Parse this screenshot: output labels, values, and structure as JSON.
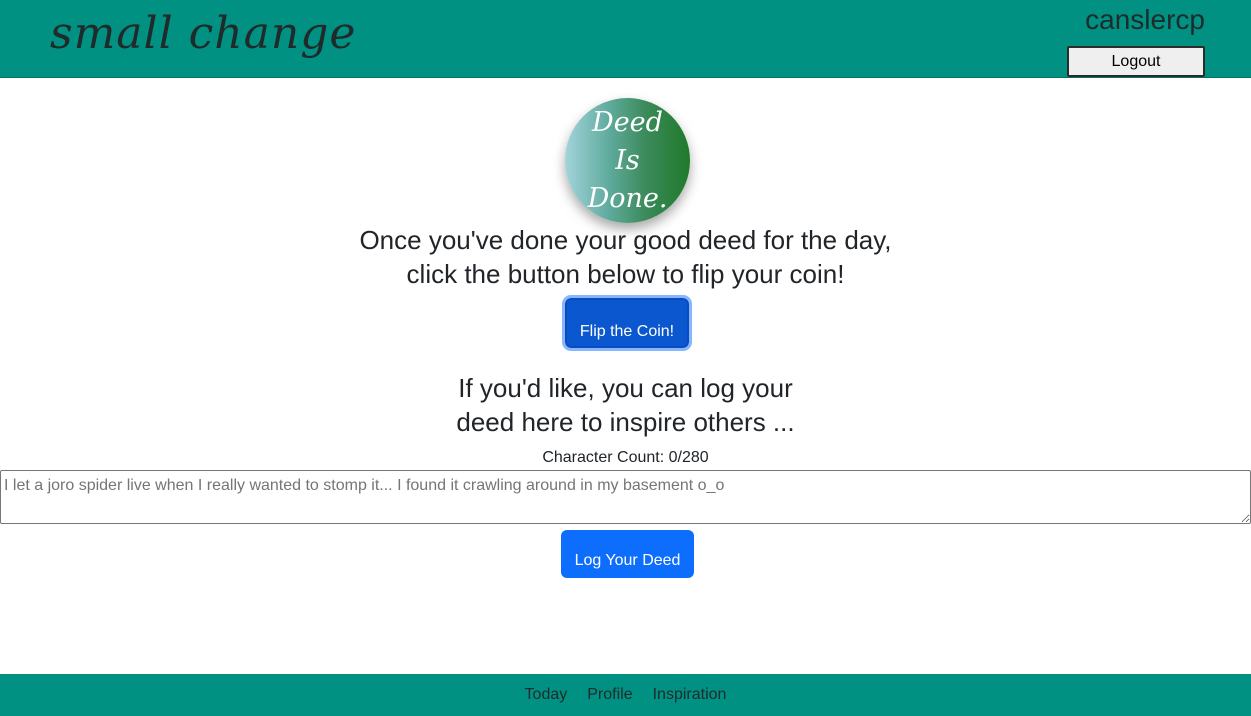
{
  "header": {
    "brand": "small change",
    "username": "canslercp",
    "logout_label": "Logout"
  },
  "coin": {
    "line1": "Deed",
    "line2": "Is",
    "line3": "Done."
  },
  "main": {
    "prompt_line1": "Once you've done your good deed for the day,",
    "prompt_line2": "click the button below to flip your coin!",
    "flip_label": "Flip the Coin!",
    "log_prompt_line1": "If you'd like, you can log your",
    "log_prompt_line2": "deed here to inspire others ...",
    "char_count": "Character Count: 0/280",
    "deed_placeholder": "I let a joro spider live when I really wanted to stomp it... I found it crawling around in my basement o_o",
    "deed_value": "",
    "log_label": "Log Your Deed"
  },
  "footer": {
    "nav": [
      "Today",
      "Profile",
      "Inspiration"
    ]
  },
  "colors": {
    "header_bg": "#009183",
    "footer_bg": "#009183",
    "primary_button": "#0d6efd",
    "flip_button": "#0b57d0"
  }
}
